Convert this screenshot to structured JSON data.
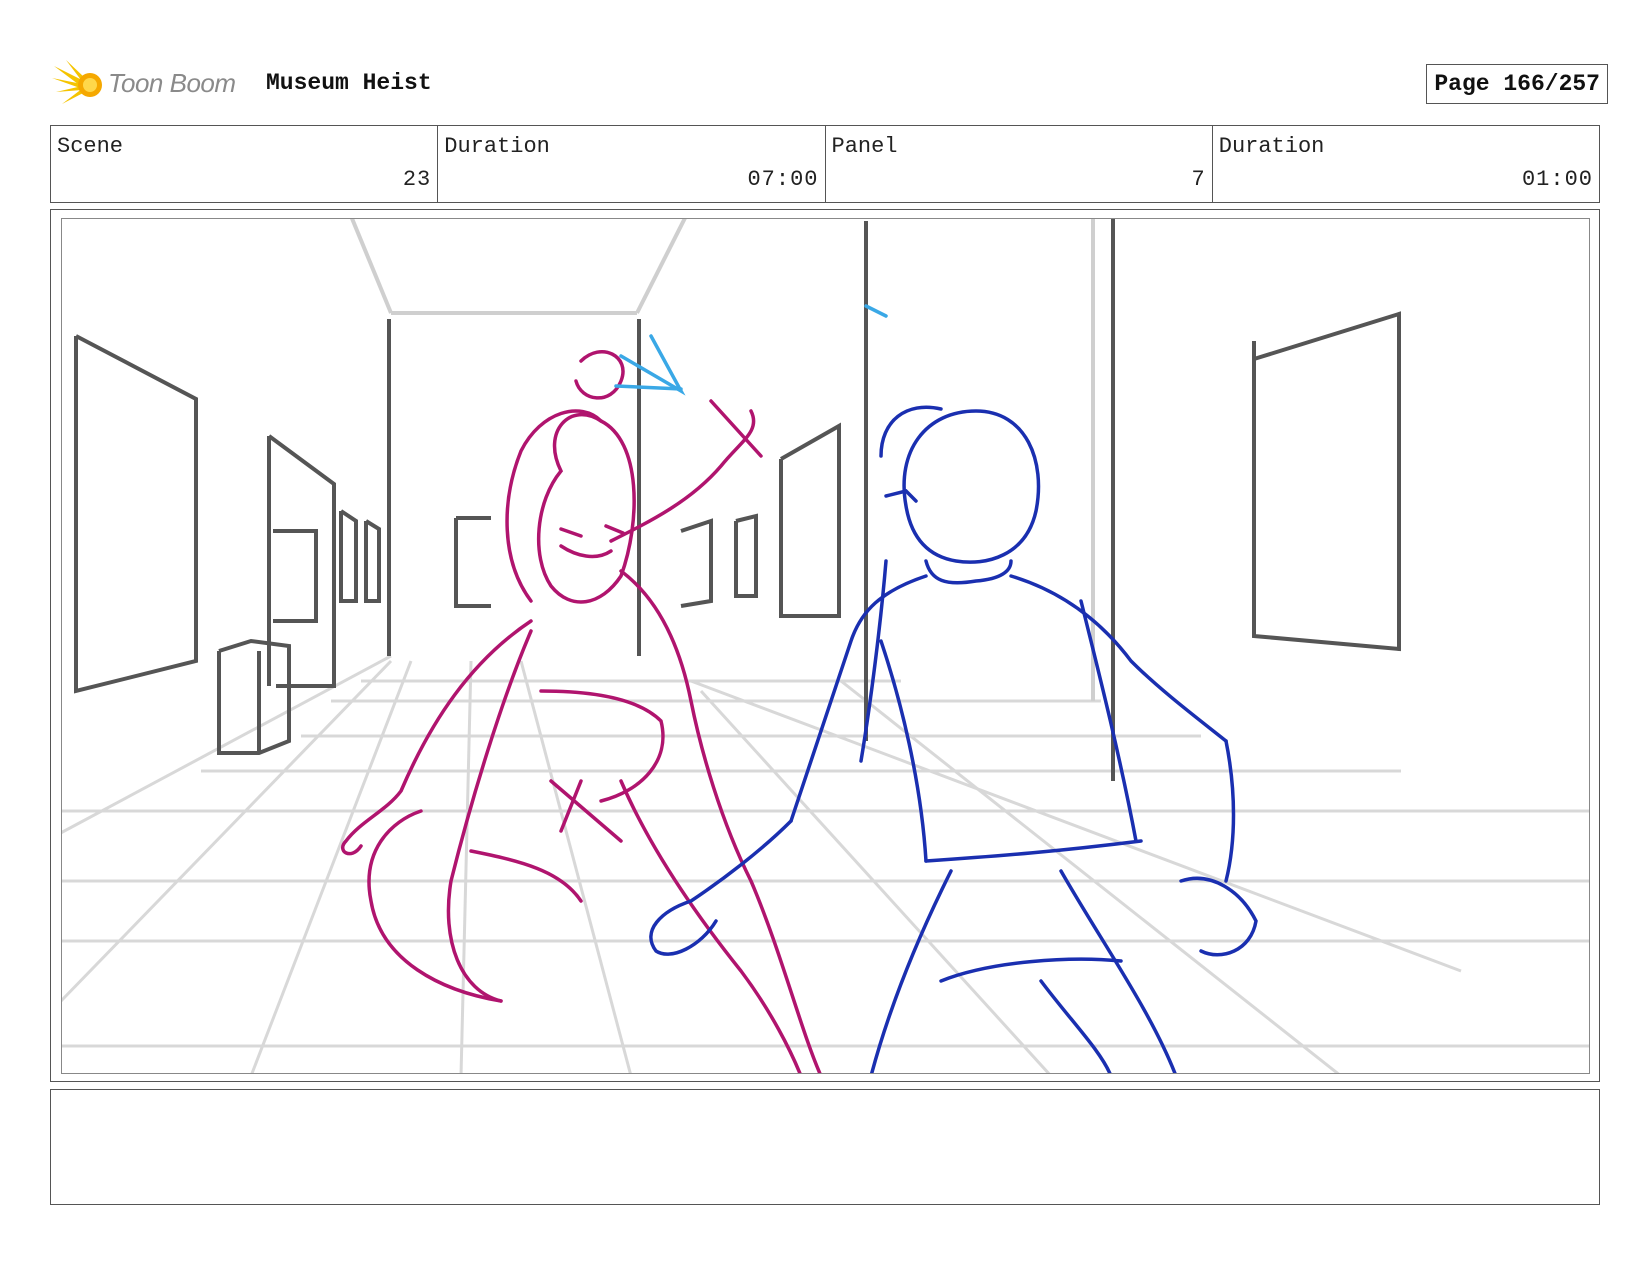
{
  "header": {
    "logo_text": "Toon Boom",
    "project_title": "Museum Heist",
    "page_label": "Page 166/257"
  },
  "info": {
    "scene_label": "Scene",
    "scene_value": "23",
    "scene_duration_label": "Duration",
    "scene_duration_value": "07:00",
    "panel_label": "Panel",
    "panel_value": "7",
    "panel_duration_label": "Duration",
    "panel_duration_value": "01:00"
  },
  "colors": {
    "accent_logo": "#f5c400",
    "sketch_magenta": "#b0146e",
    "sketch_blue": "#1a2fb0",
    "sketch_cyan": "#3aa8e6",
    "background_grey": "#cfcfcf"
  },
  "notes": {
    "text": ""
  }
}
